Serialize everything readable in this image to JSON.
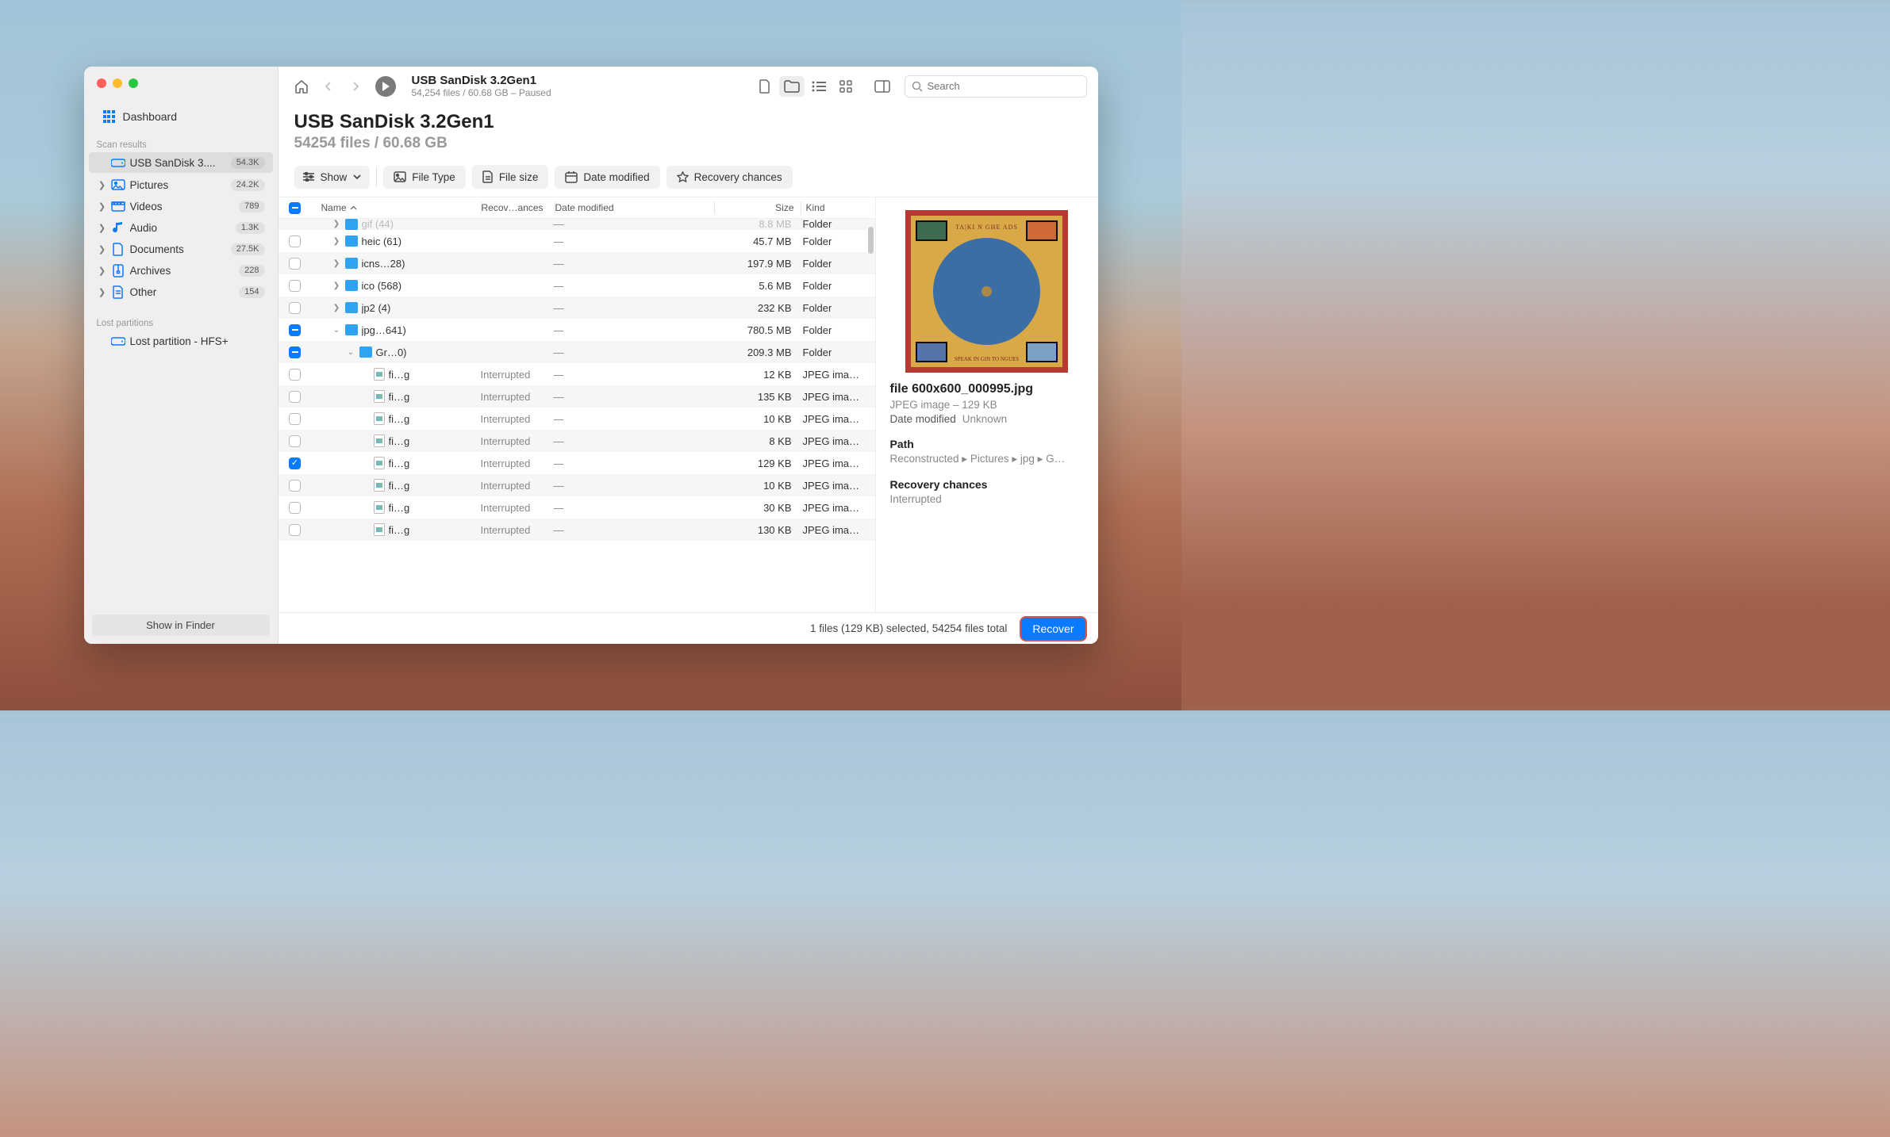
{
  "toolbar": {
    "title": "USB  SanDisk 3.2Gen1",
    "subtitle": "54,254 files / 60.68 GB – Paused",
    "search_placeholder": "Search"
  },
  "sidebar": {
    "dashboard": "Dashboard",
    "section_scan": "Scan results",
    "scan_device": {
      "label": "USB  SanDisk 3....",
      "badge": "54.3K"
    },
    "cats": [
      {
        "label": "Pictures",
        "badge": "24.2K"
      },
      {
        "label": "Videos",
        "badge": "789"
      },
      {
        "label": "Audio",
        "badge": "1.3K"
      },
      {
        "label": "Documents",
        "badge": "27.5K"
      },
      {
        "label": "Archives",
        "badge": "228"
      },
      {
        "label": "Other",
        "badge": "154"
      }
    ],
    "section_lost": "Lost partitions",
    "lost_item": "Lost partition - HFS+",
    "finder_btn": "Show in Finder"
  },
  "heading": {
    "title": "USB  SanDisk 3.2Gen1",
    "subtitle": "54254 files / 60.68 GB"
  },
  "filters": {
    "show": "Show",
    "filetype": "File Type",
    "filesize": "File size",
    "datemod": "Date modified",
    "recchance": "Recovery chances"
  },
  "columns": {
    "name": "Name",
    "rec": "Recov…ances",
    "date": "Date modified",
    "size": "Size",
    "kind": "Kind"
  },
  "rows": [
    {
      "indent": 2,
      "disc": "right",
      "check": "none",
      "icon": "folder",
      "name": "gif (44)",
      "rec": "",
      "date": "—",
      "size": "8.8 MB",
      "kind": "Folder",
      "cut": true
    },
    {
      "indent": 2,
      "disc": "right",
      "check": "empty",
      "icon": "folder",
      "name": "heic (61)",
      "rec": "",
      "date": "—",
      "size": "45.7 MB",
      "kind": "Folder"
    },
    {
      "indent": 2,
      "disc": "right",
      "check": "empty",
      "icon": "folder",
      "name": "icns…28)",
      "rec": "",
      "date": "—",
      "size": "197.9 MB",
      "kind": "Folder"
    },
    {
      "indent": 2,
      "disc": "right",
      "check": "empty",
      "icon": "folder",
      "name": "ico (568)",
      "rec": "",
      "date": "—",
      "size": "5.6 MB",
      "kind": "Folder"
    },
    {
      "indent": 2,
      "disc": "right",
      "check": "empty",
      "icon": "folder",
      "name": "jp2 (4)",
      "rec": "",
      "date": "—",
      "size": "232 KB",
      "kind": "Folder"
    },
    {
      "indent": 2,
      "disc": "down",
      "check": "minus",
      "icon": "folder",
      "name": "jpg…641)",
      "rec": "",
      "date": "—",
      "size": "780.5 MB",
      "kind": "Folder"
    },
    {
      "indent": 3,
      "disc": "down",
      "check": "minus",
      "icon": "folder",
      "name": "Gr…0)",
      "rec": "",
      "date": "—",
      "size": "209.3 MB",
      "kind": "Folder"
    },
    {
      "indent": 4,
      "disc": "",
      "check": "empty",
      "icon": "jpeg",
      "name": "fi…g",
      "rec": "Interrupted",
      "date": "—",
      "size": "12 KB",
      "kind": "JPEG ima…"
    },
    {
      "indent": 4,
      "disc": "",
      "check": "empty",
      "icon": "jpeg",
      "name": "fi…g",
      "rec": "Interrupted",
      "date": "—",
      "size": "135 KB",
      "kind": "JPEG ima…"
    },
    {
      "indent": 4,
      "disc": "",
      "check": "empty",
      "icon": "jpeg",
      "name": "fi…g",
      "rec": "Interrupted",
      "date": "—",
      "size": "10 KB",
      "kind": "JPEG ima…"
    },
    {
      "indent": 4,
      "disc": "",
      "check": "empty",
      "icon": "jpeg",
      "name": "fi…g",
      "rec": "Interrupted",
      "date": "—",
      "size": "8 KB",
      "kind": "JPEG ima…"
    },
    {
      "indent": 4,
      "disc": "",
      "check": "check",
      "icon": "jpeg",
      "name": "fi…g",
      "rec": "Interrupted",
      "date": "—",
      "size": "129 KB",
      "kind": "JPEG ima…"
    },
    {
      "indent": 4,
      "disc": "",
      "check": "empty",
      "icon": "jpeg",
      "name": "fi…g",
      "rec": "Interrupted",
      "date": "—",
      "size": "10 KB",
      "kind": "JPEG ima…"
    },
    {
      "indent": 4,
      "disc": "",
      "check": "empty",
      "icon": "jpeg",
      "name": "fi…g",
      "rec": "Interrupted",
      "date": "—",
      "size": "30 KB",
      "kind": "JPEG ima…"
    },
    {
      "indent": 4,
      "disc": "",
      "check": "empty",
      "icon": "jpeg",
      "name": "fi…g",
      "rec": "Interrupted",
      "date": "—",
      "size": "130 KB",
      "kind": "JPEG ima…"
    }
  ],
  "preview": {
    "thumb_top": "TA|KI N GHE ADS",
    "thumb_bot": "SPEAK IN GIN TO NGUES",
    "filename": "file 600x600_000995.jpg",
    "type_size": "JPEG image – 129 KB",
    "date_k": "Date modified",
    "date_v": "Unknown",
    "path_h": "Path",
    "path_v": "Reconstructed ▸ Pictures ▸ jpg ▸ G…",
    "rec_h": "Recovery chances",
    "rec_v": "Interrupted"
  },
  "footer": {
    "status": "1 files (129 KB) selected, 54254 files total",
    "recover": "Recover"
  }
}
